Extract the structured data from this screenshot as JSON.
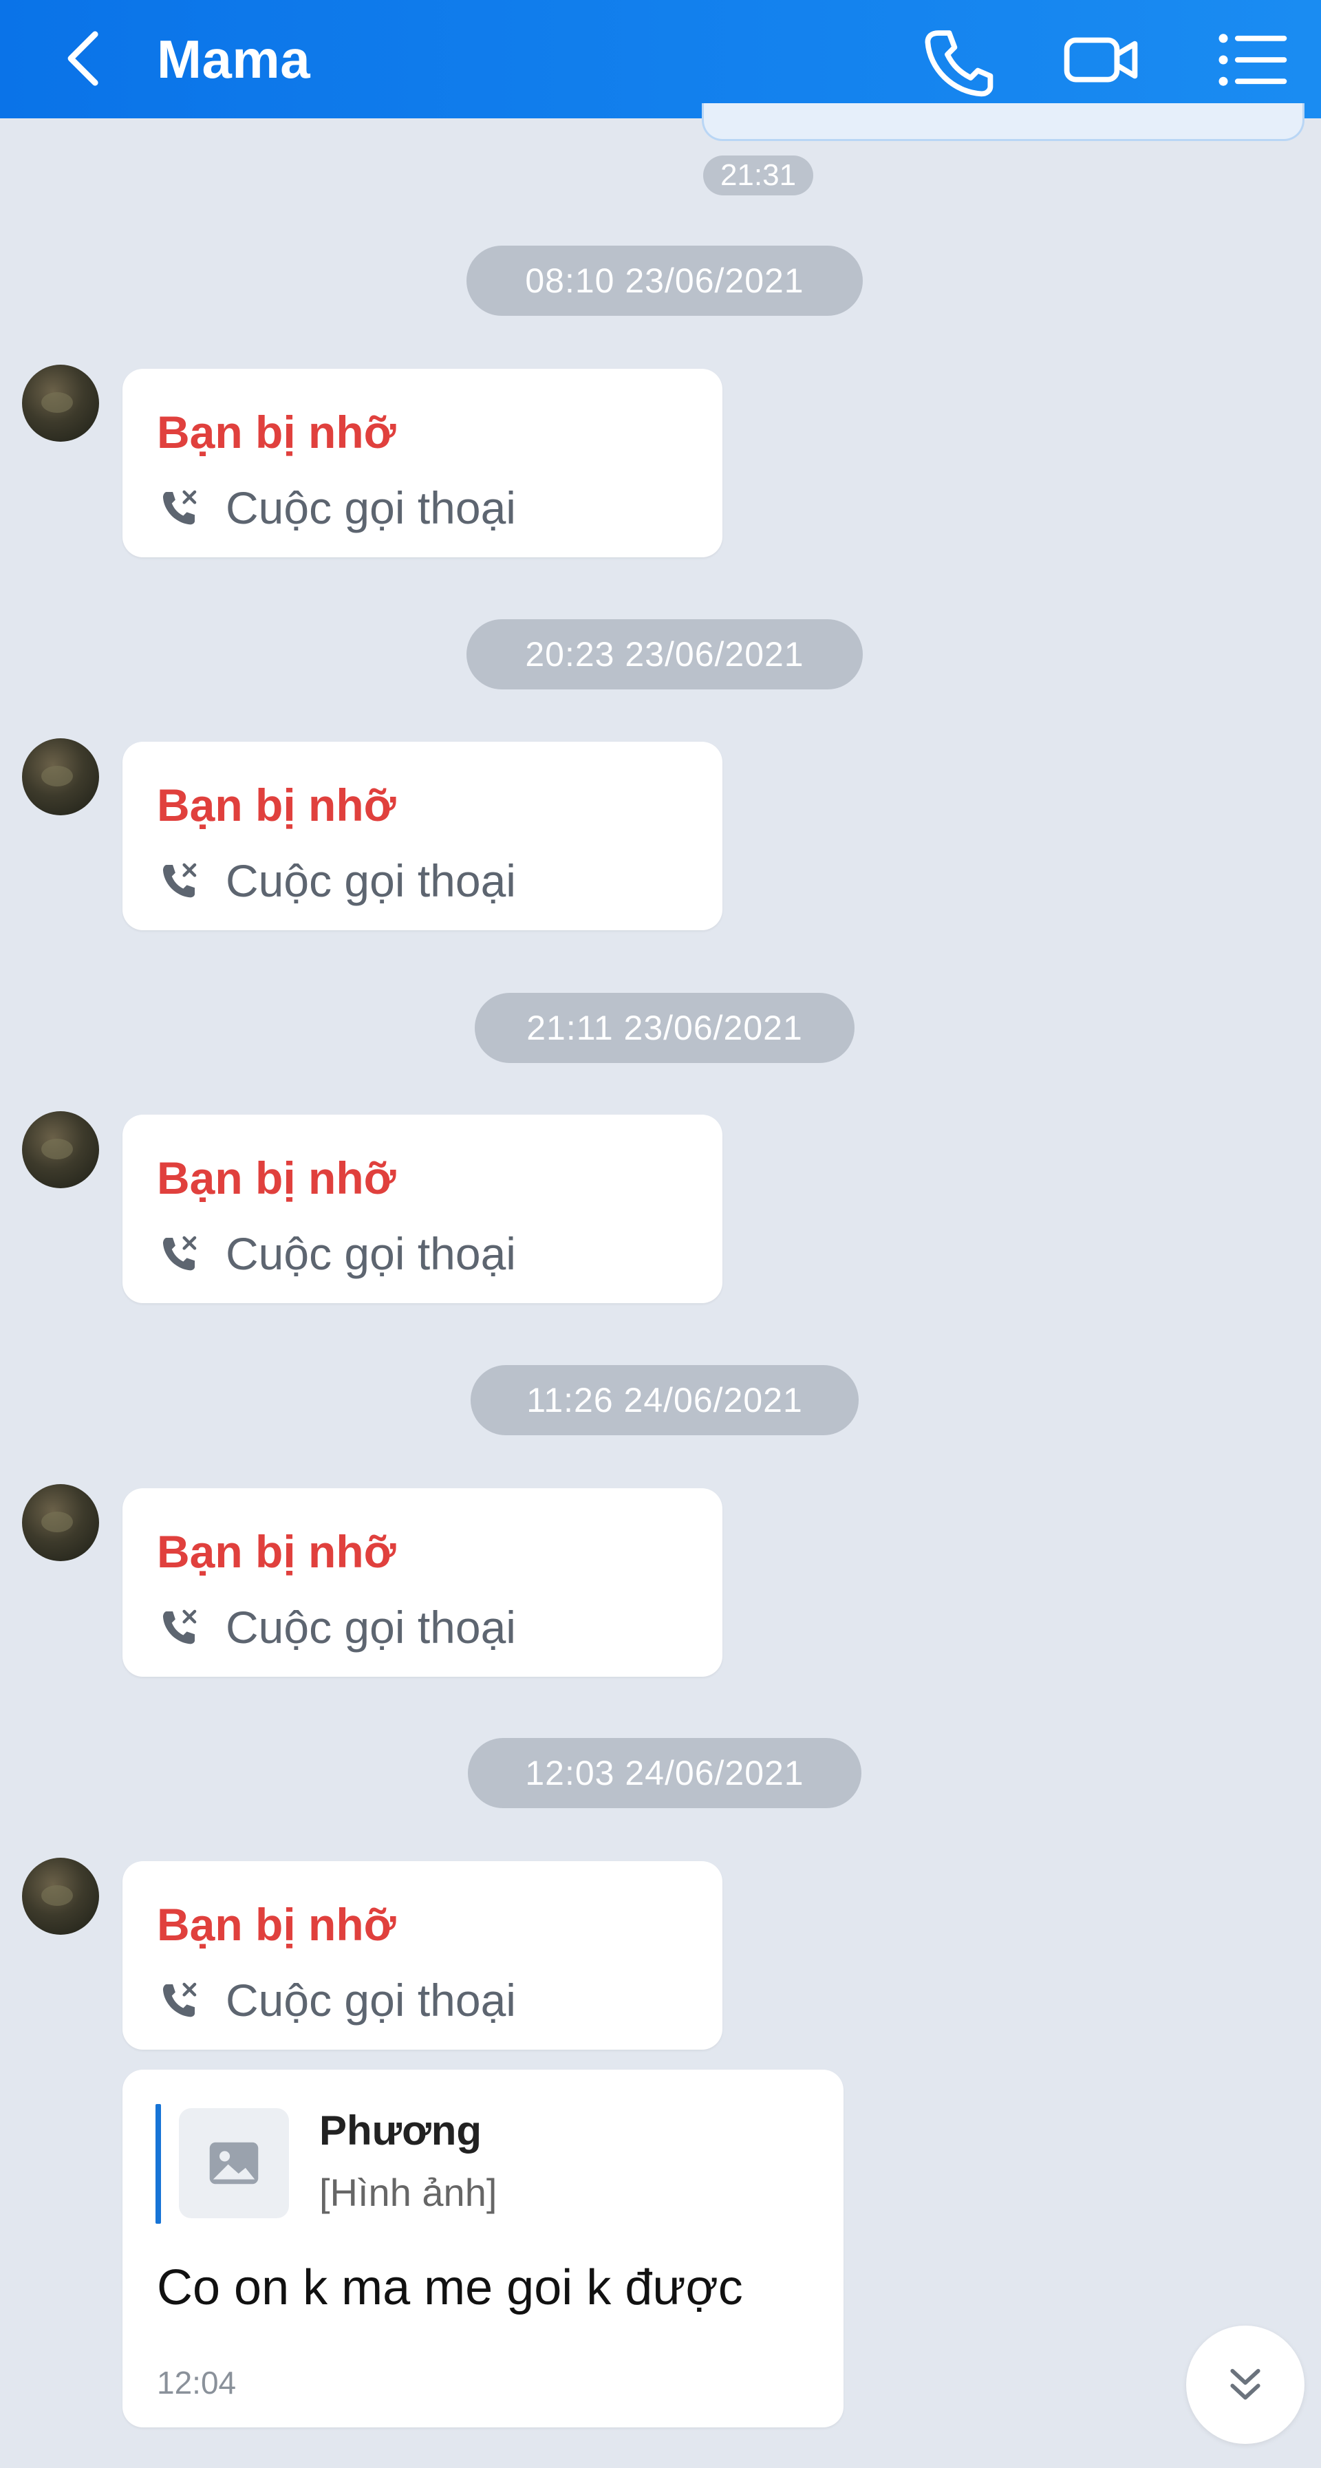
{
  "header": {
    "title": "Mama",
    "icons": [
      "back-chevron-icon",
      "phone-icon",
      "video-camera-icon",
      "list-menu-icon"
    ]
  },
  "prev_message_time": "21:31",
  "calls": [
    {
      "date": "08:10 23/06/2021",
      "status": "Bạn bị nhỡ",
      "label": "Cuộc gọi thoại",
      "icon": "missed-call-icon"
    },
    {
      "date": "20:23 23/06/2021",
      "status": "Bạn bị nhỡ",
      "label": "Cuộc gọi thoại",
      "icon": "missed-call-icon"
    },
    {
      "date": "21:11 23/06/2021",
      "status": "Bạn bị nhỡ",
      "label": "Cuộc gọi thoại",
      "icon": "missed-call-icon"
    },
    {
      "date": "11:26 24/06/2021",
      "status": "Bạn bị nhỡ",
      "label": "Cuộc gọi thoại",
      "icon": "missed-call-icon"
    },
    {
      "date": "12:03 24/06/2021",
      "status": "Bạn bị nhỡ",
      "label": "Cuộc gọi thoại",
      "icon": "missed-call-icon"
    }
  ],
  "reply": {
    "quote_name": "Phương",
    "quote_type": "[Hình ảnh]",
    "text": "Co on k ma me goi k được",
    "time": "12:04"
  },
  "colors": {
    "header": "#0a73e8",
    "background": "#e2e7ef",
    "missed": "#e0403d",
    "quote_bar": "#1774d6"
  }
}
